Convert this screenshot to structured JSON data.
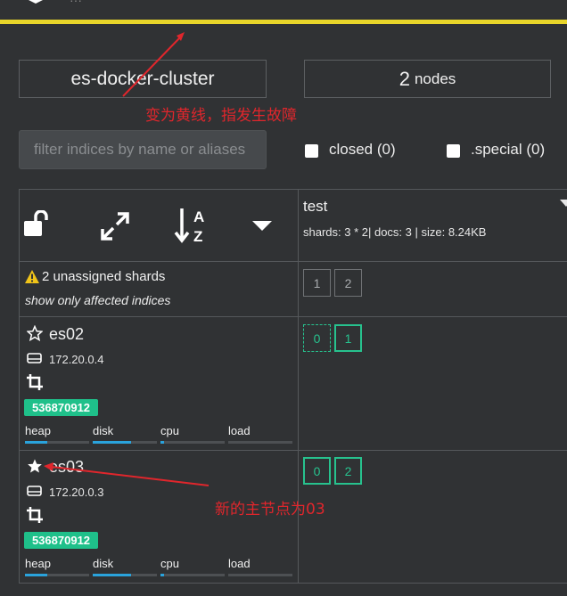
{
  "header": {
    "logo_icon": "elasticsearch-hq-logo-icon",
    "status_color": "#e8d52a"
  },
  "cluster": {
    "name": "es-docker-cluster",
    "node_count": "2",
    "node_label": "nodes"
  },
  "filter": {
    "placeholder": "filter indices by name or aliases"
  },
  "checkboxes": {
    "closed": "closed (0)",
    "special": ".special (0)"
  },
  "toolbar": {
    "icons": [
      "unlock-icon",
      "expand-icon",
      "sort-alpha-down-icon",
      "caret-down-icon"
    ],
    "sort_top": "A",
    "sort_bottom": "Z"
  },
  "index": {
    "name": "test",
    "meta": "shards: 3 * 2| docs: 3 | size: 8.24KB"
  },
  "unassigned": {
    "label": "2 unassigned shards",
    "link": "show only affected indices",
    "shards": [
      "1",
      "2"
    ]
  },
  "nodes": [
    {
      "name": "es02",
      "master": false,
      "ip": "172.20.0.4",
      "id": "536870912",
      "shards": [
        {
          "label": "0",
          "state": "initializing"
        },
        {
          "label": "1",
          "state": "started"
        }
      ],
      "metrics": [
        {
          "label": "heap",
          "value": 0.35
        },
        {
          "label": "disk",
          "value": 0.6
        },
        {
          "label": "cpu",
          "value": 0.06
        },
        {
          "label": "load",
          "value": 0.0
        }
      ]
    },
    {
      "name": "es03",
      "master": true,
      "ip": "172.20.0.3",
      "id": "536870912",
      "shards": [
        {
          "label": "0",
          "state": "started"
        },
        {
          "label": "2",
          "state": "started"
        }
      ],
      "metrics": [
        {
          "label": "heap",
          "value": 0.35
        },
        {
          "label": "disk",
          "value": 0.6
        },
        {
          "label": "cpu",
          "value": 0.06
        },
        {
          "label": "load",
          "value": 0.0
        }
      ]
    }
  ],
  "annotations": {
    "yellow_line": "变为黄线，指发生故障",
    "new_master": "新的主节点为03",
    "color": "#e0262c"
  }
}
